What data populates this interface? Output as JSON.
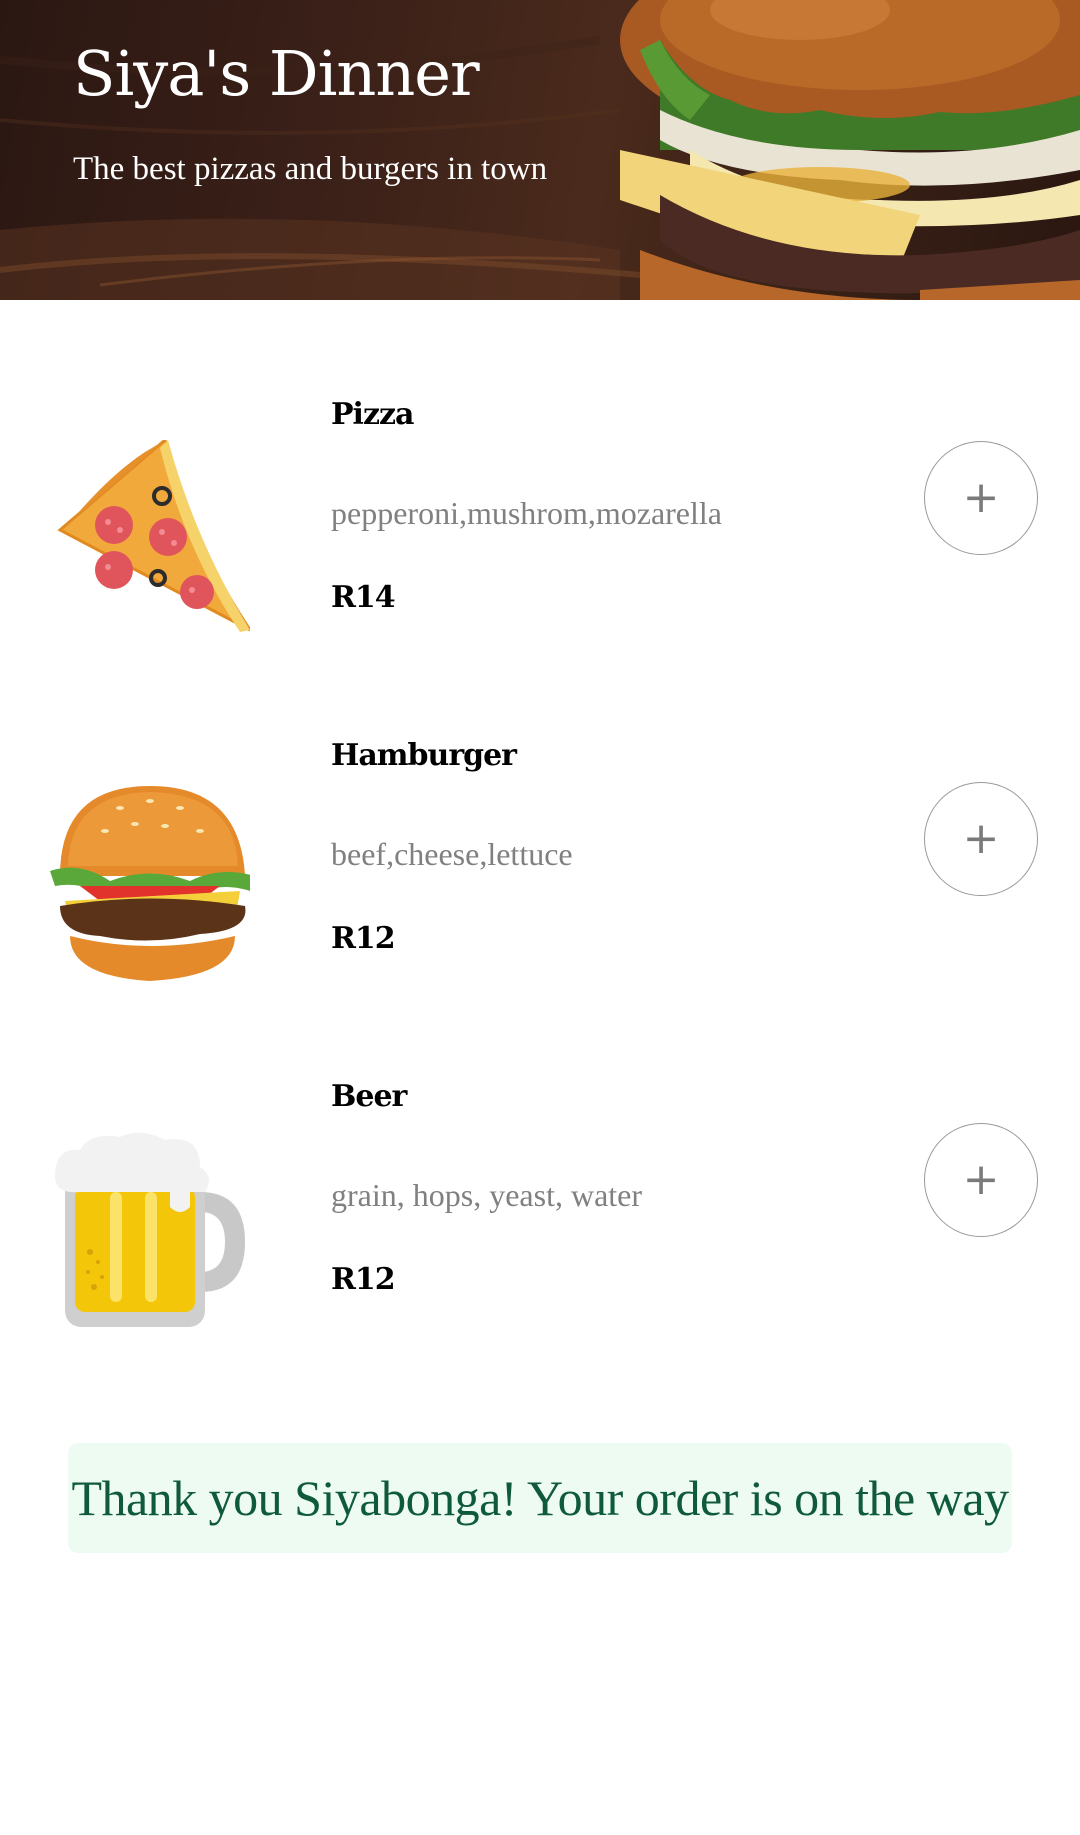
{
  "header": {
    "title": "Siya's Dinner",
    "subtitle": "The best pizzas and burgers in town"
  },
  "menu": {
    "items": [
      {
        "name": "Pizza",
        "description": "pepperoni,mushrom,mozarella",
        "price": "R14",
        "icon": "pizza-icon",
        "add_label": "+"
      },
      {
        "name": "Hamburger",
        "description": "beef,cheese,lettuce",
        "price": "R12",
        "icon": "hamburger-icon",
        "add_label": "+"
      },
      {
        "name": "Beer",
        "description": "grain, hops, yeast, water",
        "price": "R12",
        "icon": "beer-mug-icon",
        "add_label": "+"
      }
    ]
  },
  "confirmation": {
    "message": "Thank you Siyabonga! Your order is on the way"
  },
  "colors": {
    "confirmation_background": "#edfbf3",
    "confirmation_text": "#0f5a3a",
    "description_text": "#808080"
  }
}
